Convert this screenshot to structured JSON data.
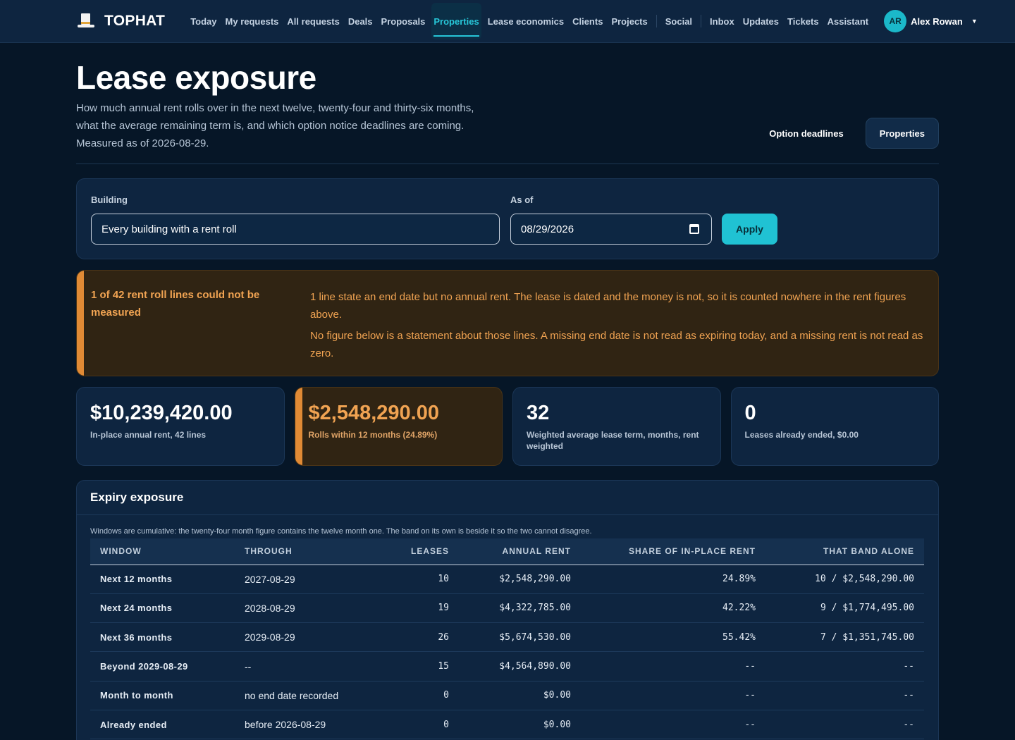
{
  "brand": {
    "name": "TOPHAT",
    "logo_icon": "top-hat-icon"
  },
  "nav": {
    "items": [
      {
        "label": "Today"
      },
      {
        "label": "My requests"
      },
      {
        "label": "All requests"
      },
      {
        "label": "Deals"
      },
      {
        "label": "Proposals"
      },
      {
        "label": "Properties",
        "active": true
      },
      {
        "label": "Lease economics"
      },
      {
        "label": "Clients"
      },
      {
        "label": "Projects"
      },
      {
        "label": "Social"
      },
      {
        "label": "Inbox"
      },
      {
        "label": "Updates"
      },
      {
        "label": "Tickets"
      },
      {
        "label": "Assistant"
      }
    ],
    "user": {
      "initials": "AR",
      "name": "Alex Rowan"
    }
  },
  "header": {
    "title": "Lease exposure",
    "description": "How much annual rent rolls over in the next twelve, twenty-four and thirty-six months, what the average remaining term is, and which option notice deadlines are coming. Measured as of 2026-08-29.",
    "actions": {
      "option_deadlines": "Option deadlines",
      "properties": "Properties"
    }
  },
  "filters": {
    "building_label": "Building",
    "building_value": "Every building with a rent roll",
    "as_of_label": "As of",
    "as_of_value": "08/29/2026",
    "apply_label": "Apply"
  },
  "alert": {
    "title": "1 of 42 rent roll lines could not be measured",
    "body_1": "1 line state an end date but no annual rent. The lease is dated and the money is not, so it is counted nowhere in the rent figures above.",
    "body_2": "No figure below is a statement about those lines. A missing end date is not read as expiring today, and a missing rent is not read as zero.",
    "accent_color": "#e08a35"
  },
  "stats": [
    {
      "value": "$10,239,420.00",
      "label": "In-place annual rent, 42 lines"
    },
    {
      "value": "$2,548,290.00",
      "label": "Rolls within 12 months (24.89%)"
    },
    {
      "value": "32",
      "label": "Weighted average lease term, months, rent weighted"
    },
    {
      "value": "0",
      "label": "Leases already ended, $0.00"
    }
  ],
  "exposure": {
    "title": "Expiry exposure",
    "note": "Windows are cumulative: the twenty-four month figure contains the twelve month one. The band on its own is beside it so the two cannot disagree.",
    "columns": [
      "Window",
      "Through",
      "Leases",
      "Annual rent",
      "Share of in-place rent",
      "That band alone"
    ],
    "rows": [
      {
        "window": "Next 12 months",
        "through": "2027-08-29",
        "leases": "10",
        "rent": "$2,548,290.00",
        "share": "24.89%",
        "band": "10 / $2,548,290.00"
      },
      {
        "window": "Next 24 months",
        "through": "2028-08-29",
        "leases": "19",
        "rent": "$4,322,785.00",
        "share": "42.22%",
        "band": "9 / $1,774,495.00"
      },
      {
        "window": "Next 36 months",
        "through": "2029-08-29",
        "leases": "26",
        "rent": "$5,674,530.00",
        "share": "55.42%",
        "band": "7 / $1,351,745.00"
      },
      {
        "window": "Beyond 2029-08-29",
        "through": "--",
        "leases": "15",
        "rent": "$4,564,890.00",
        "share": "--",
        "band": "--"
      },
      {
        "window": "Month to month",
        "through": "no end date recorded",
        "leases": "0",
        "rent": "$0.00",
        "share": "--",
        "band": "--"
      },
      {
        "window": "Already ended",
        "through": "before 2026-08-29",
        "leases": "0",
        "rent": "$0.00",
        "share": "--",
        "band": "--"
      }
    ]
  },
  "colors": {
    "accent": "#20c2d3",
    "warning": "#e08a35",
    "background": "#061627",
    "panel": "#0e2540"
  }
}
